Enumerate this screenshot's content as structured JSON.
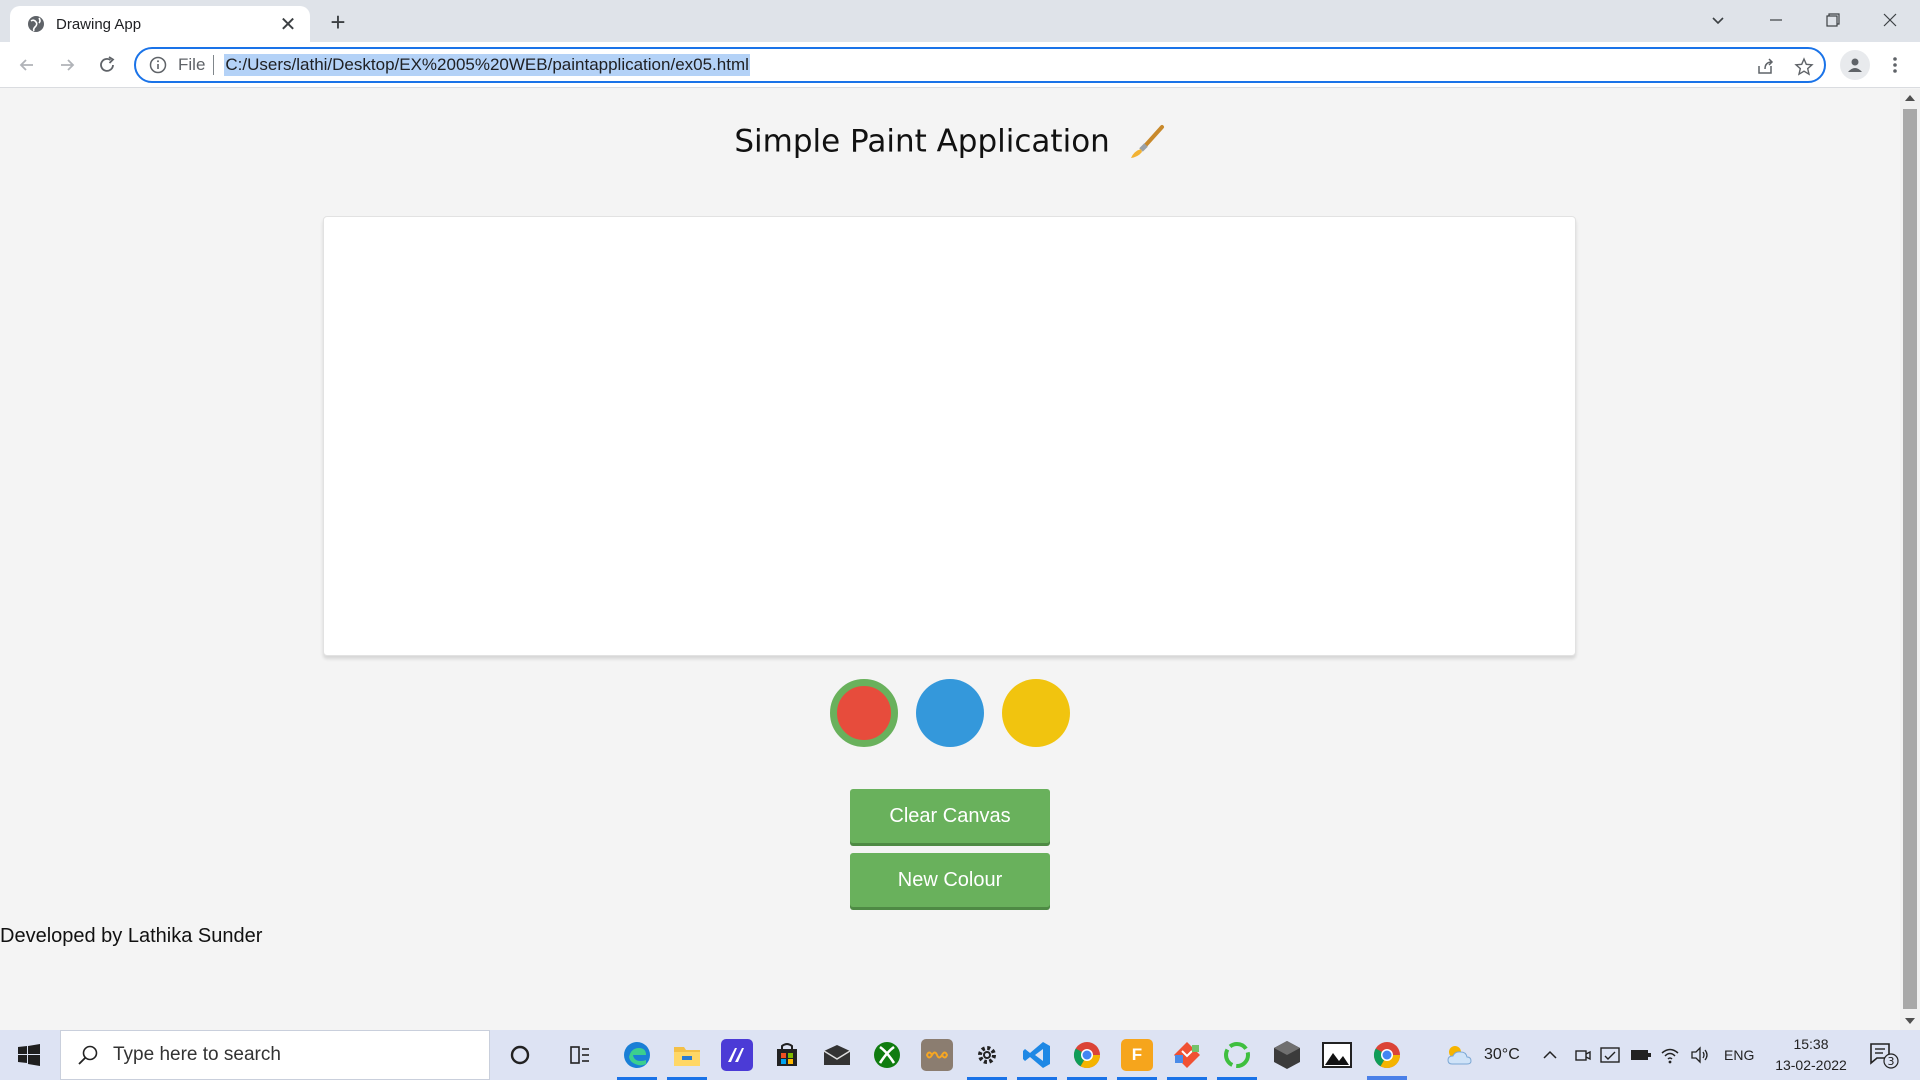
{
  "browser": {
    "tab_title": "Drawing App",
    "tab_close": "✕",
    "new_tab": "+",
    "scheme": "File",
    "url": "C:/Users/lathi/Desktop/EX%2005%20WEB/paintapplication/ex05.html"
  },
  "page": {
    "title": "Simple Paint Application",
    "swatches": [
      {
        "color": "#e74c3c",
        "selected": true
      },
      {
        "color": "#3498db",
        "selected": false
      },
      {
        "color": "#f1c40f",
        "selected": false
      }
    ],
    "clear_button": "Clear Canvas",
    "new_colour_button": "New Colour",
    "footer": "Developed by Lathika Sunder",
    "accent_color": "#69b15c"
  },
  "taskbar": {
    "search_placeholder": "Type here to search",
    "weather": "30°C",
    "language": "ENG",
    "time": "15:38",
    "date": "13-02-2022",
    "notifications": "3",
    "apps": [
      "cortana-icon",
      "task-view-icon",
      "edge-icon",
      "file-explorer-icon",
      "app-icon",
      "store-icon",
      "mail-icon",
      "xbox-icon",
      "app-icon",
      "settings-icon",
      "vscode-icon",
      "chrome-icon",
      "app-icon",
      "app-icon",
      "app-icon",
      "app-icon",
      "photos-icon",
      "chrome-icon"
    ]
  }
}
